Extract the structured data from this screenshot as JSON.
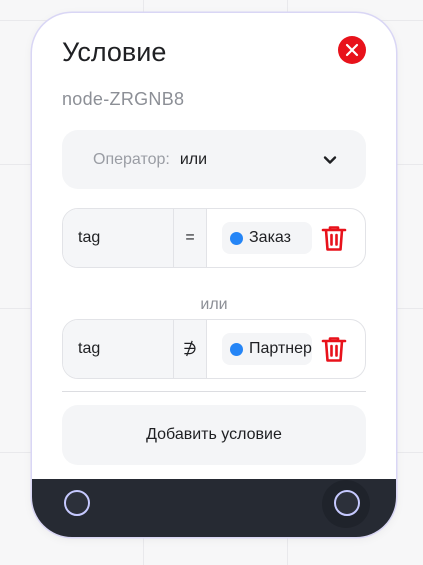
{
  "node": {
    "title": "Условие",
    "id": "node-ZRGNB8"
  },
  "operator": {
    "label": "Оператор:",
    "value": "или"
  },
  "conditions": [
    {
      "field": "tag",
      "operator": "=",
      "value": "Заказ"
    },
    {
      "field": "tag",
      "operator": "∌",
      "value": "Партнер"
    }
  ],
  "separator": "или",
  "add_button": "Добавить условие",
  "colors": {
    "close": "#e8121b",
    "delete": "#e8121b",
    "value_dot": "#2585f6",
    "footer": "#262a33",
    "handle_border": "#c6c9ff"
  },
  "icons": {
    "close": "close-icon",
    "chevron": "chevron-down-icon",
    "delete": "trash-icon",
    "value_marker": "dot-icon",
    "connector": "circle-handle"
  }
}
